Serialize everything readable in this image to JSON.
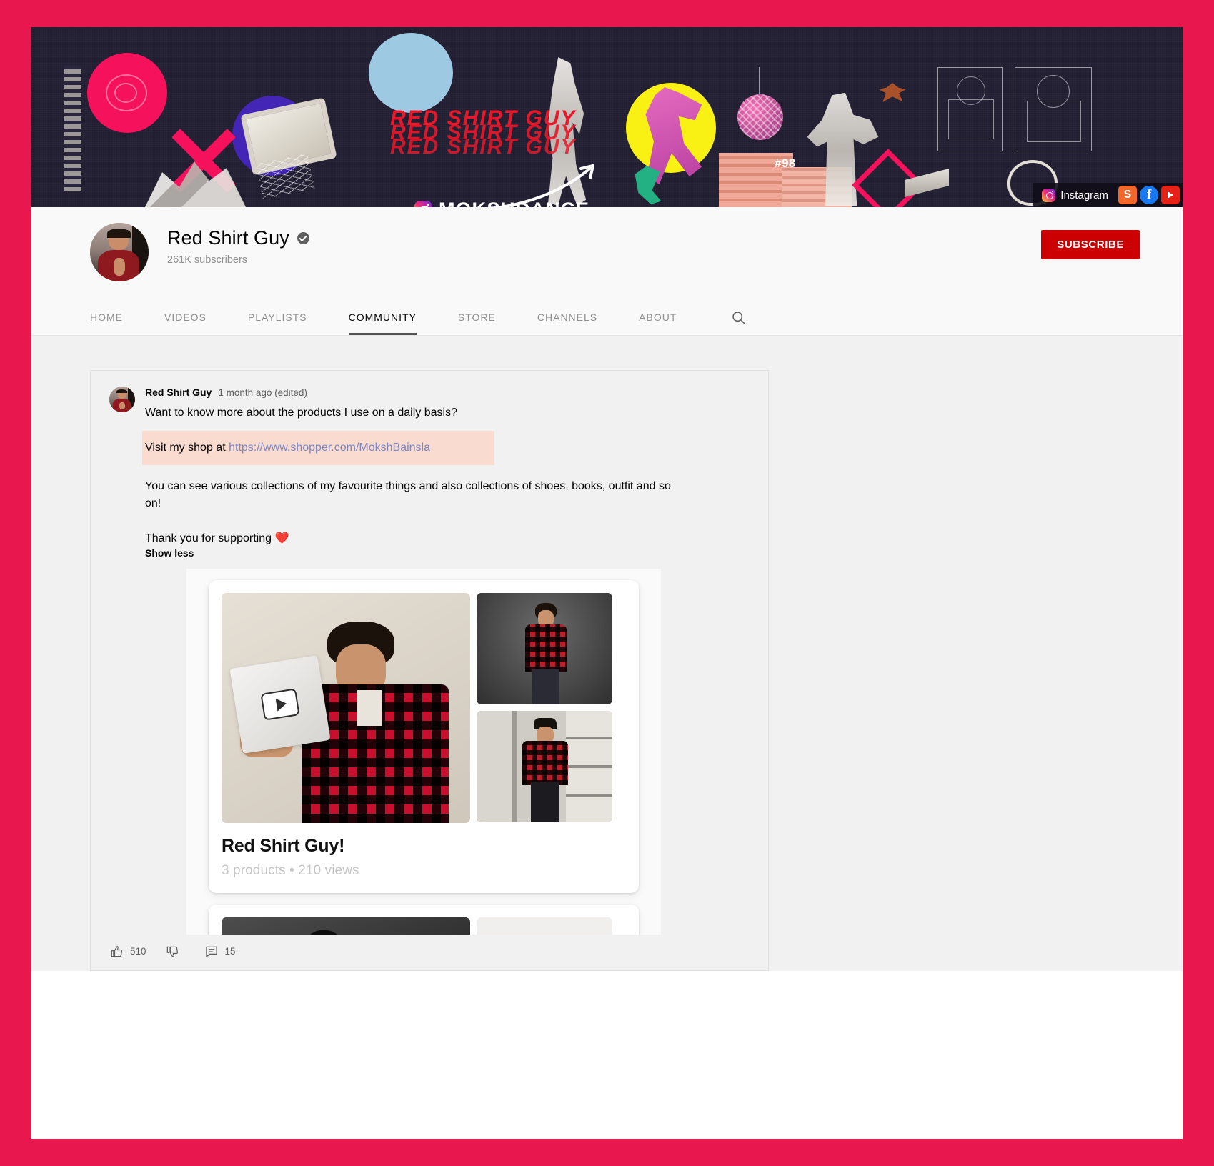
{
  "banner": {
    "brand_lines": [
      "RED SHIRT GUY",
      "RED SHIRT GUY",
      "RED SHIRT GUY"
    ],
    "handle": "MOKSHDANCE",
    "number_tag": "#98",
    "social_links": [
      {
        "name": "instagram-link",
        "label": "Instagram",
        "icon": "instagram-icon",
        "color": "#ee2a7b"
      },
      {
        "name": "shopper-link",
        "label": "S",
        "icon": "shopper-icon",
        "color": "#f2682a"
      },
      {
        "name": "facebook-link",
        "label": "f",
        "icon": "facebook-icon",
        "color": "#1778f2"
      },
      {
        "name": "youtube-link",
        "label": "",
        "icon": "youtube-icon",
        "color": "#e62117"
      }
    ]
  },
  "channel": {
    "name": "Red Shirt Guy",
    "verified": true,
    "subscribers": "261K subscribers",
    "subscribe_label": "SUBSCRIBE",
    "subscribe_color": "#cc0000",
    "avatar_alt": "channel-avatar"
  },
  "tabs": [
    {
      "label": "HOME",
      "active": false
    },
    {
      "label": "VIDEOS",
      "active": false
    },
    {
      "label": "PLAYLISTS",
      "active": false
    },
    {
      "label": "COMMUNITY",
      "active": true
    },
    {
      "label": "STORE",
      "active": false
    },
    {
      "label": "CHANNELS",
      "active": false
    },
    {
      "label": "ABOUT",
      "active": false
    }
  ],
  "search": {
    "icon": "search-icon"
  },
  "post": {
    "author": "Red Shirt Guy",
    "timestamp": "1 month ago (edited)",
    "line1": "Want to know more about the products I use on a daily basis?",
    "highlight_prefix": "Visit my shop at ",
    "highlight_link": "https://www.shopper.com/MokshBainsla",
    "highlight_bg": "#f9dbd0",
    "paragraph": "You can see various collections of my favourite things and also collections of shoes, books, outfit and so on!",
    "thanks": "Thank you for supporting ❤️",
    "show_less": "Show less",
    "actions": {
      "like_icon": "thumbs-up-icon",
      "like_count": "510",
      "dislike_icon": "thumbs-down-icon",
      "dislike_count": "",
      "comment_icon": "comment-icon",
      "comment_count": "15"
    }
  },
  "store_cards": [
    {
      "title": "Red Shirt Guy!",
      "meta": "3 products  •  210 views",
      "images": [
        "plaque-photo",
        "red-plaid-studio-photo",
        "red-plaid-window-photo"
      ]
    },
    {
      "title": "",
      "meta": "",
      "images": [
        "bw-portrait-photo",
        "red-sneaker-photo"
      ]
    }
  ],
  "theme": {
    "frame_color": "#e8184f",
    "page_bg": "#ffffff",
    "content_bg": "#f1f1f1",
    "banner_bg": "#221f32"
  }
}
